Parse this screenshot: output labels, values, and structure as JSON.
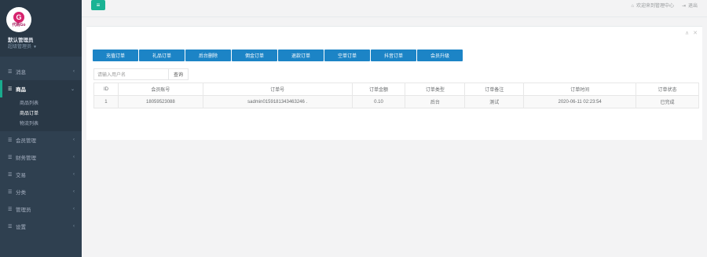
{
  "sidebar": {
    "logo": {
      "mark": "G",
      "text": "代购Go"
    },
    "profile": {
      "name": "默认管理员",
      "role": "超级管理员"
    },
    "items": [
      {
        "icon": "list-icon",
        "label": "消息"
      },
      {
        "icon": "list-icon",
        "label": "商品",
        "active": true,
        "children": [
          "商品列表",
          "商品订单",
          "物流列表"
        ]
      },
      {
        "icon": "list-icon",
        "label": "会员管理"
      },
      {
        "icon": "list-icon",
        "label": "财务管理"
      },
      {
        "icon": "list-icon",
        "label": "交易"
      },
      {
        "icon": "list-icon",
        "label": "分类"
      },
      {
        "icon": "list-icon",
        "label": "管理员"
      },
      {
        "icon": "list-icon",
        "label": "设置"
      }
    ]
  },
  "topbar": {
    "menu_toggle_icon": "hamburger-icon",
    "welcome": "欢迎来到管理中心",
    "logout": "退出"
  },
  "panel": {
    "tools": [
      "∧",
      "✕"
    ],
    "buttons": [
      "充值订单",
      "礼品订单",
      "后台删除",
      "佣金订单",
      "退款订单",
      "空单订单",
      "抖音订单",
      "会员升级"
    ],
    "search": {
      "placeholder": "请输入用户名",
      "button": "查询"
    },
    "table": {
      "columns": [
        "ID",
        "会员账号",
        "订单号",
        "订单金额",
        "订单类型",
        "订单备注",
        "订单时间",
        "订单状态"
      ],
      "rows": [
        [
          "1",
          "18059523088",
          "sadmin0159181343463246 .",
          "0.10",
          "后台",
          "测试",
          "2020-06-11 02:23:54",
          "已完成"
        ]
      ]
    }
  },
  "colors": {
    "sidebar": "#2f4050",
    "accent": "#1ab394",
    "button": "#1c84c6"
  }
}
